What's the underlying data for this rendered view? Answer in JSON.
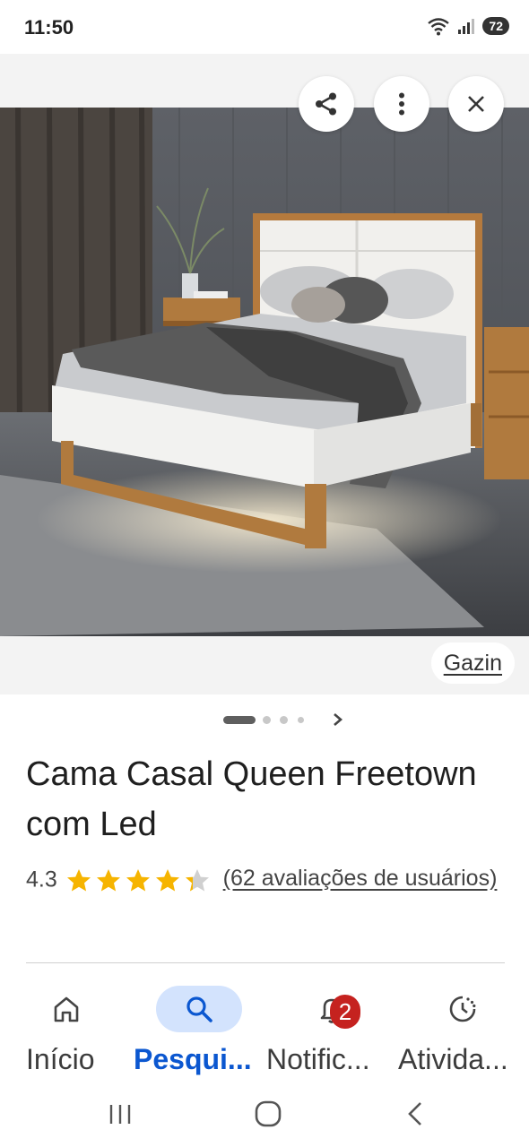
{
  "status_bar": {
    "time": "11:50",
    "battery": "72",
    "icons": [
      "wifi-icon",
      "signal-icon",
      "battery-icon"
    ]
  },
  "viewer": {
    "actions": [
      "share-icon",
      "more-vert-icon",
      "close-icon"
    ],
    "source": "Gazin"
  },
  "pager": {
    "pages": 4,
    "current": 1
  },
  "product": {
    "title": "Cama Casal Queen Freetown com Led",
    "rating": "4.3",
    "rating_value": 4.3,
    "stars_max": 5,
    "reviews_link": "(62 avaliações de usuários)"
  },
  "bottom_nav": {
    "items": [
      {
        "label": "Início",
        "icon": "home-icon",
        "active": false
      },
      {
        "label": "Pesqui...",
        "icon": "search-icon",
        "active": true
      },
      {
        "label": "Notific...",
        "icon": "bell-icon",
        "active": false,
        "badge": "2"
      },
      {
        "label": "Ativida...",
        "icon": "history-icon",
        "active": false
      }
    ]
  },
  "system_nav": [
    "recents-icon",
    "home-circle-icon",
    "back-icon"
  ],
  "colors": {
    "accent": "#0b57d0",
    "active_pill": "#d3e3fd",
    "star": "#f6b400",
    "badge": "#c5221f"
  }
}
